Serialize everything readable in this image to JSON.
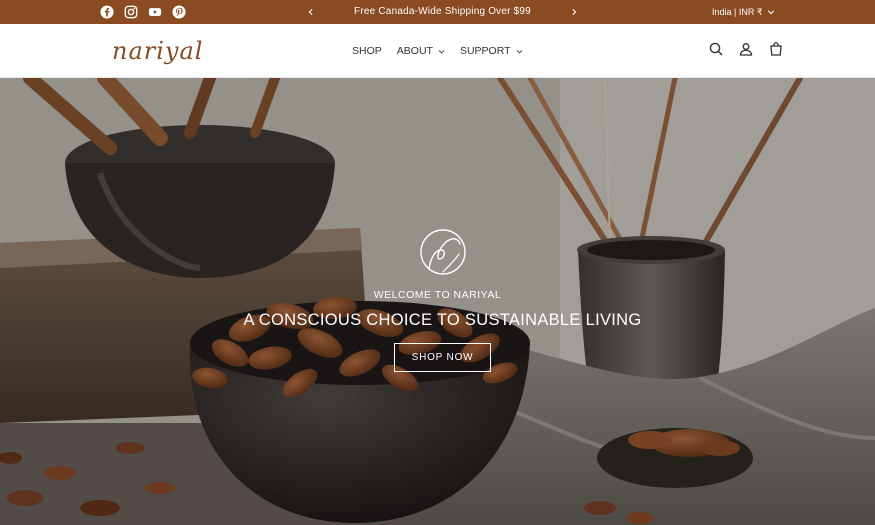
{
  "announcement": {
    "text": "Free Canada-Wide Shipping Over $99",
    "locale": "India | INR ₹",
    "social": [
      "facebook-icon",
      "instagram-icon",
      "youtube-icon",
      "pinterest-icon"
    ]
  },
  "header": {
    "logo_text": "nariyal",
    "nav": [
      {
        "label": "SHOP"
      },
      {
        "label": "ABOUT"
      },
      {
        "label": "SUPPORT"
      }
    ],
    "icons": [
      "search-icon",
      "account-icon",
      "cart-icon"
    ]
  },
  "hero": {
    "kicker": "WELCOME TO NARIYAL",
    "title": "A CONSCIOUS CHOICE TO SUSTAINABLE LIVING",
    "button": "SHOP NOW"
  },
  "colors": {
    "brand": "#8a4a22",
    "header_bg": "#ffffff",
    "hero_text": "#ffffff"
  }
}
